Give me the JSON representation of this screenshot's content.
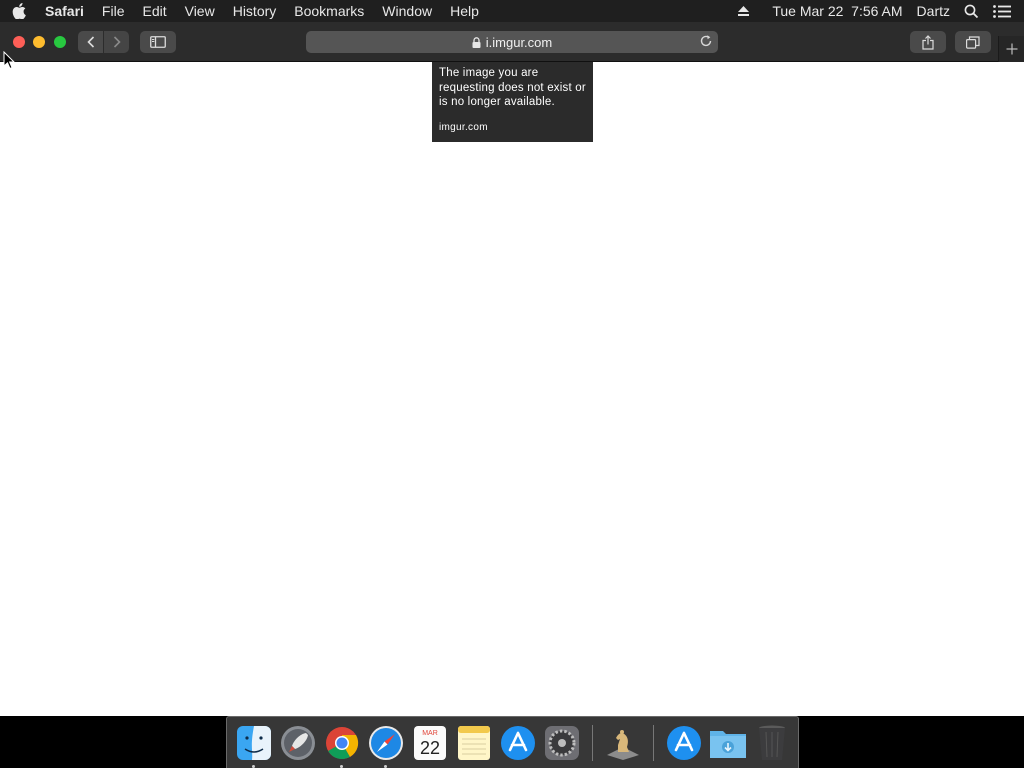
{
  "menubar": {
    "app_name": "Safari",
    "items": [
      "File",
      "Edit",
      "View",
      "History",
      "Bookmarks",
      "Window",
      "Help"
    ],
    "clock": "Tue Mar 22  7:56 AM",
    "user": "Dartz"
  },
  "toolbar": {
    "url": "i.imgur.com"
  },
  "page": {
    "error_message": "The image you are requesting does not exist or is no longer available.",
    "site_label": "imgur.com"
  },
  "dock": {
    "calendar_month": "MAR",
    "calendar_day": "22"
  }
}
